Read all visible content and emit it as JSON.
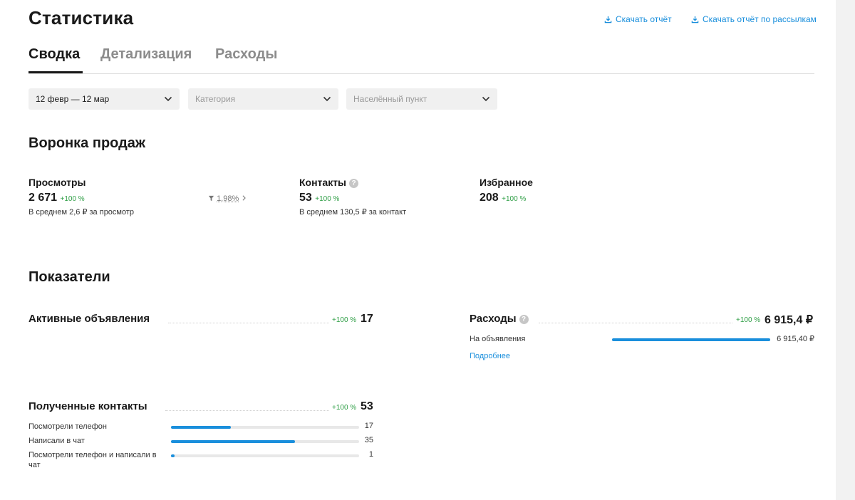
{
  "header": {
    "title": "Статистика",
    "download_report": "Скачать отчёт",
    "download_mailing_report": "Скачать отчёт по рассылкам"
  },
  "tabs": [
    {
      "label": "Сводка",
      "active": true
    },
    {
      "label": "Детализация",
      "active": false
    },
    {
      "label": "Расходы",
      "active": false
    }
  ],
  "filters": {
    "period": "12 февр — 12 мар",
    "category_placeholder": "Категория",
    "location_placeholder": "Населённый пункт"
  },
  "funnel": {
    "title": "Воронка продаж",
    "views": {
      "label": "Просмотры",
      "value": "2 671",
      "change": "+100 %",
      "sub": "В среднем 2,6 ₽ за просмотр"
    },
    "conversion": "1,98%",
    "contacts": {
      "label": "Контакты",
      "value": "53",
      "change": "+100 %",
      "sub": "В среднем 130,5 ₽ за контакт"
    },
    "favorites": {
      "label": "Избранное",
      "value": "208",
      "change": "+100 %"
    }
  },
  "indicators": {
    "title": "Показатели",
    "active_ads": {
      "label": "Активные объявления",
      "change": "+100 %",
      "value": "17"
    },
    "expenses": {
      "label": "Расходы",
      "change": "+100 %",
      "value": "6 915,4 ₽",
      "rows": [
        {
          "label": "На объявления",
          "value": "6 915,40 ₽",
          "fraction": 1.0
        }
      ],
      "more_link": "Подробнее"
    },
    "contacts_received": {
      "label": "Полученные контакты",
      "change": "+100 %",
      "value": "53",
      "rows": [
        {
          "label": "Посмотрели телефон",
          "value": "17",
          "fraction": 0.32
        },
        {
          "label": "Написали в чат",
          "value": "35",
          "fraction": 0.66
        },
        {
          "label": "Посмотрели телефон и написали в чат",
          "value": "1",
          "fraction": 0.02
        }
      ]
    }
  },
  "colors": {
    "accent": "#1a8fdc",
    "positive": "#2e9e45",
    "muted": "#8c8c8c"
  },
  "icons": {
    "download": "download-icon",
    "chevron": "chevron-down-icon",
    "funnel": "funnel-icon",
    "info": "info-icon"
  }
}
